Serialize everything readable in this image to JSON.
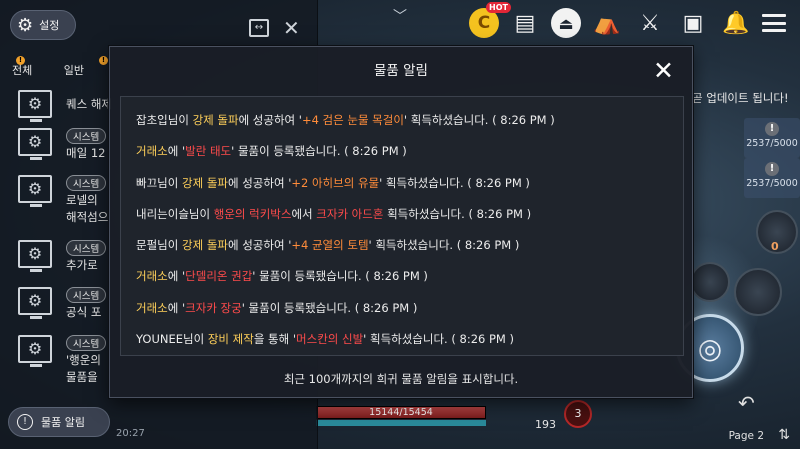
{
  "top_icons": {
    "hot_badge": "HOT",
    "coin_letter": "C"
  },
  "chat": {
    "settings_label": "설정",
    "tabs": [
      "전체",
      "일반"
    ],
    "tab_badge": "!",
    "rows": [
      {
        "msg": "퀘스 해제"
      },
      {
        "badge": "시스템",
        "msg": "매일 12"
      },
      {
        "badge": "시스템",
        "msg": "로넬의",
        "msg2": "해적섬으"
      },
      {
        "badge": "시스템",
        "msg": "추가로"
      },
      {
        "badge": "시스템",
        "msg": "공식 포"
      },
      {
        "badge": "시스템",
        "msg": "'행운의",
        "msg2": "물품을"
      }
    ],
    "item_alert_label": "물품 알림",
    "status_text": "20:27"
  },
  "side": {
    "notice": "곧 업데이트 됩니다!",
    "resource_mark": "!",
    "resource_1": "2537/5000",
    "resource_2": "2537/5000",
    "slot_count": "0",
    "page": "Page 2"
  },
  "hud": {
    "hp_text": "15144/15454",
    "num": "193",
    "potion": "3"
  },
  "modal": {
    "title": "물품 알림",
    "close": "✕",
    "footer": "최근 100개까지의 희귀 물품 알림을 표시합니다.",
    "entries": [
      {
        "p": [
          "잡초입",
          "님이 ",
          "강제 돌파",
          "에 성공하여 '",
          "+4 검은 눈물 목걸이",
          "' 획득하셨습니다. ( 8:26 PM )"
        ],
        "c": [
          "",
          "",
          "y",
          "",
          "o",
          ""
        ]
      },
      {
        "p": [
          "거래소",
          "에 '",
          "발란 태도",
          "' 물품이 등록됐습니다. ( 8:26 PM )"
        ],
        "c": [
          "y",
          "",
          "r",
          ""
        ]
      },
      {
        "p": [
          "빠끄",
          "님이 ",
          "강제 돌파",
          "에 성공하여 '",
          "+2 아히브의 유물",
          "' 획득하셨습니다. ( 8:26 PM )"
        ],
        "c": [
          "",
          "",
          "y",
          "",
          "o",
          ""
        ]
      },
      {
        "p": [
          "내리는이슬",
          "님이 ",
          "행운의 럭키박스",
          "에서 ",
          "크자카 아드혼",
          " 획득하셨습니다. ( 8:26 PM )"
        ],
        "c": [
          "",
          "",
          "r",
          "",
          "r",
          ""
        ]
      },
      {
        "p": [
          "문펄",
          "님이 ",
          "강제 돌파",
          "에 성공하여 '",
          "+4 균열의 토템",
          "' 획득하셨습니다. ( 8:26 PM )"
        ],
        "c": [
          "",
          "",
          "y",
          "",
          "o",
          ""
        ]
      },
      {
        "p": [
          "거래소",
          "에 '",
          "단델리온 권갑",
          "' 물품이 등록됐습니다. ( 8:26 PM )"
        ],
        "c": [
          "y",
          "",
          "r",
          ""
        ]
      },
      {
        "p": [
          "거래소",
          "에 '",
          "크자카 장궁",
          "' 물품이 등록됐습니다. ( 8:26 PM )"
        ],
        "c": [
          "y",
          "",
          "r",
          ""
        ]
      },
      {
        "p": [
          "YOUNEE",
          "님이 ",
          "장비 제작",
          "을 통해 '",
          "머스칸의 신발",
          "' 획득하셨습니다. ( 8:26 PM )"
        ],
        "c": [
          "",
          "",
          "y",
          "",
          "r",
          ""
        ]
      }
    ]
  }
}
